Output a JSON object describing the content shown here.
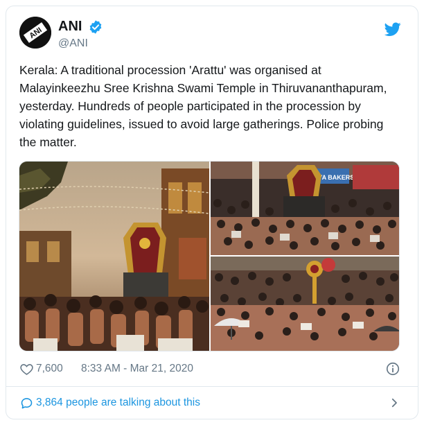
{
  "author": {
    "name": "ANI",
    "handle": "@ANI",
    "avatar_text": "ANI",
    "verified": true
  },
  "tweet": {
    "text": "Kerala: A traditional procession 'Arattu' was organised at Malayinkeezhu Sree Krishna Swami Temple in Thiruvananthapuram, yesterday. Hundreds of people participated in the procession by violating guidelines, issued to avoid large gatherings. Police probing the matter."
  },
  "media": {
    "photos": [
      {
        "caption": "procession-at-dusk-with-decorated-elephant"
      },
      {
        "caption": "crowd-in-street-with-elephant-and-shop-signs",
        "sign_text": "ARYA BAKERS"
      },
      {
        "caption": "crowd-with-umbrellas-and-ornamental-parasols"
      }
    ]
  },
  "meta": {
    "likes": "7,600",
    "timestamp": "8:33 AM - Mar 21, 2020"
  },
  "footer": {
    "talking": "3,864 people are talking about this"
  },
  "icons": {
    "brand": "twitter-bird-icon",
    "verified": "verified-badge-icon",
    "like": "heart-icon",
    "info": "info-icon",
    "reply": "speech-bubble-icon",
    "chevron": "chevron-right-icon"
  },
  "colors": {
    "twitter_blue": "#1da1f2",
    "link_blue": "#1b95e0",
    "secondary_text": "#657786",
    "border": "#e1e8ed"
  }
}
